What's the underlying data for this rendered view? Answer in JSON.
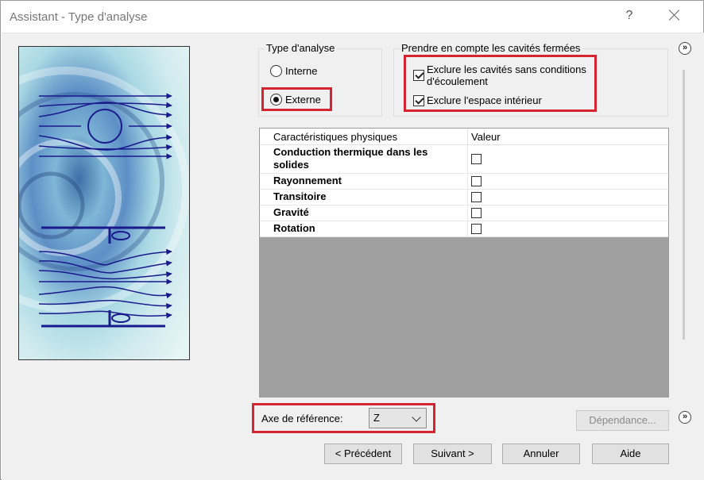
{
  "window": {
    "title": "Assistant - Type d'analyse",
    "help_symbol": "?",
    "close_symbol": "close-icon"
  },
  "analysis_type": {
    "legend": "Type d'analyse",
    "options": [
      {
        "label": "Interne",
        "selected": false
      },
      {
        "label": "Externe",
        "selected": true
      }
    ]
  },
  "closed_cavities": {
    "legend": "Prendre en compte les cavités fermées",
    "options": [
      {
        "label_line1": "Exclure les cavités sans conditions",
        "label_line2": "d'écoulement",
        "checked": true
      },
      {
        "label": "Exclure l'espace intérieur",
        "checked": true
      }
    ]
  },
  "physical_features": {
    "header_feature": "Caractéristiques physiques",
    "header_value": "Valeur",
    "rows": [
      {
        "line1": "Conduction thermique dans les",
        "line2": "solides",
        "checked": false
      },
      {
        "label": "Rayonnement",
        "checked": false
      },
      {
        "label": "Transitoire",
        "checked": false
      },
      {
        "label": "Gravité",
        "checked": false
      },
      {
        "label": "Rotation",
        "checked": false
      }
    ]
  },
  "reference_axis": {
    "label": "Axe de référence:",
    "value": "Z"
  },
  "buttons": {
    "dependency": "Dépendance...",
    "previous": "< Précédent",
    "next": "Suivant >",
    "cancel": "Annuler",
    "help": "Aide",
    "expand": "»"
  },
  "colors": {
    "highlight": "#d5232f",
    "arrows": "#1a1a8c",
    "window_bg": "#f0f0f0"
  }
}
